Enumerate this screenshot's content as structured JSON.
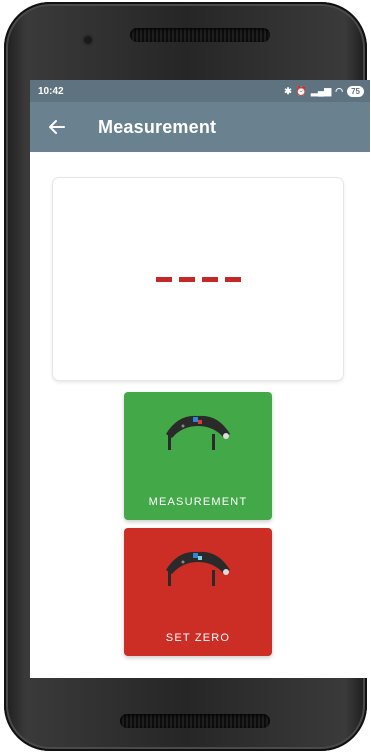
{
  "status_bar": {
    "time": "10:42",
    "icons": [
      "bluetooth-icon",
      "alarm-icon",
      "signal-icon",
      "wifi-icon",
      "battery-icon"
    ],
    "battery_level": "75"
  },
  "app_bar": {
    "title": "Measurement",
    "back_icon": "back-arrow-icon"
  },
  "display": {
    "reading": "----",
    "color": "#c62828"
  },
  "buttons": {
    "measurement": {
      "label": "MEASUREMENT",
      "color": "#43a847",
      "icon": "caliper-device-icon"
    },
    "set_zero": {
      "label": "SET ZERO",
      "color": "#cc2d25",
      "icon": "caliper-device-icon"
    }
  },
  "colors": {
    "app_bar": "#6a8290",
    "status_bar": "#5f7280"
  }
}
